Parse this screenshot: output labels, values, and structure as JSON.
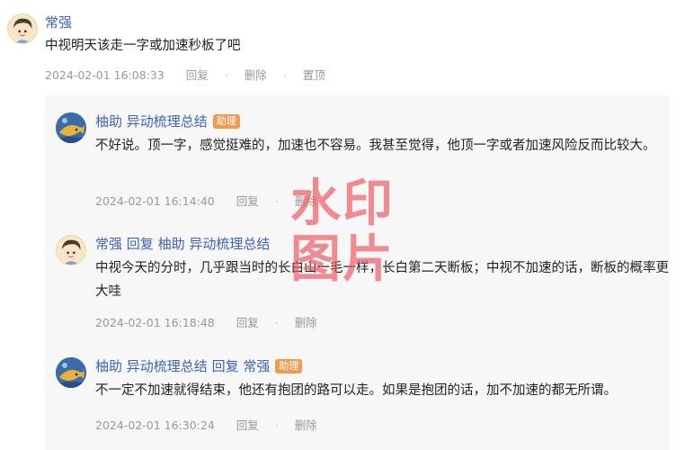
{
  "top_comment": {
    "user": "常强",
    "text": "中视明天该走一字或加速秒板了吧",
    "time": "2024-02-01 16:08:33",
    "actions": [
      "回复",
      "删除",
      "置顶"
    ]
  },
  "replies": [
    {
      "user": "柚助 异动梳理总结",
      "badge": "助理",
      "text": "不好说。顶一字，感觉挺难的，加速也不容易。我甚至觉得，他顶一字或者加速风险反而比较大。",
      "time": "2024-02-01 16:14:40",
      "actions": [
        "回复",
        "删除"
      ]
    },
    {
      "user": "常强",
      "reply_word": "回复",
      "reply_to": "柚助 异动梳理总结",
      "text": "中视今天的分时，几乎跟当时的长白山一毛一样，长白第二天断板；中视不加速的话，断板的概率更大哇",
      "time": "2024-02-01 16:18:48",
      "actions": [
        "回复",
        "删除"
      ]
    },
    {
      "user": "柚助 异动梳理总结",
      "reply_word": "回复",
      "reply_to": "常强",
      "badge": "助理",
      "text": "不一定不加速就得结束，他还有抱团的路可以走。如果是抱团的话，加不加速的都无所谓。",
      "time": "2024-02-01 16:30:24",
      "actions": [
        "回复",
        "删除"
      ]
    }
  ],
  "watermark": "水印图片",
  "dot": "·",
  "colors": {
    "link": "#3e63b8",
    "badge": "#f09a52",
    "meta": "#999999",
    "watermark": "#ec5a64"
  }
}
